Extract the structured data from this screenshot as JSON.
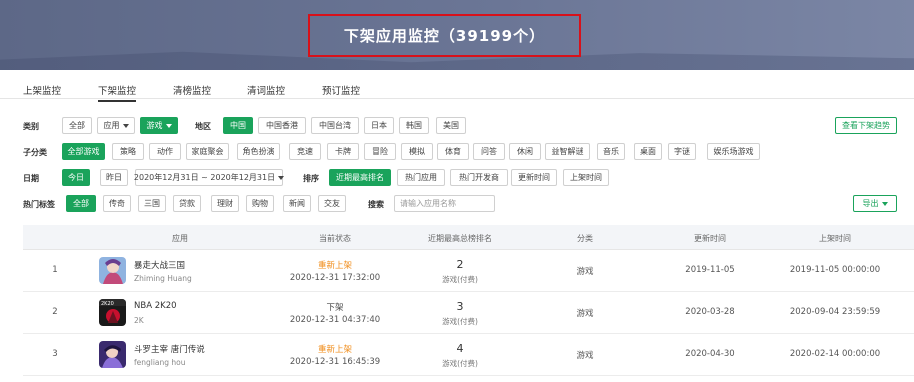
{
  "banner": {
    "title": "下架应用监控（39199个）"
  },
  "tabs": [
    {
      "label": "上架监控"
    },
    {
      "label": "下架监控"
    },
    {
      "label": "清榜监控"
    },
    {
      "label": "清词监控"
    },
    {
      "label": "预订监控"
    }
  ],
  "filters": {
    "category": {
      "label": "类别",
      "options": [
        "全部",
        "应用",
        "游戏"
      ],
      "region_label": "地区",
      "regions": [
        "中国",
        "中国香港",
        "中国台湾",
        "日本",
        "韩国",
        "美国"
      ],
      "trend_button": "查看下架趋势"
    },
    "subcategory": {
      "label": "子分类",
      "options": [
        "全部游戏",
        "策略",
        "动作",
        "家庭聚会",
        "角色扮演",
        "竞速",
        "卡牌",
        "冒险",
        "模拟",
        "体育",
        "问答",
        "休闲",
        "益智解谜",
        "音乐",
        "桌面",
        "字谜",
        "娱乐场游戏"
      ]
    },
    "date": {
      "label": "日期",
      "today": "今日",
      "yesterday": "昨日",
      "range": "2020年12月31日 ~ 2020年12月31日",
      "sort_label": "排序",
      "sorts": [
        "近期最高排名",
        "热门应用",
        "热门开发商",
        "更新时间",
        "上架时间"
      ]
    },
    "hot": {
      "label": "热门标签",
      "tags": [
        "全部",
        "传奇",
        "三国",
        "贷款",
        "理财",
        "购物",
        "新闻",
        "交友"
      ],
      "search_label": "搜索",
      "search_placeholder": "请输入应用名称",
      "export": "导出"
    }
  },
  "table": {
    "headers": [
      "应用",
      "当前状态",
      "近期最高总榜排名",
      "分类",
      "更新时间",
      "上架时间"
    ],
    "rows": [
      {
        "index": "1",
        "name": "暴走大战三国",
        "developer": "Zhiming Huang",
        "status": "重新上架",
        "status_type": "re",
        "status_time": "2020-12-31 17:32:00",
        "rank": "2",
        "rank_sub": "游戏(付费)",
        "category": "游戏",
        "updated": "2019-11-05",
        "listed": "2019-11-05 00:00:00",
        "icon": "game-icon-sanguo"
      },
      {
        "index": "2",
        "name": "NBA 2K20",
        "developer": "2K",
        "status": "下架",
        "status_type": "off",
        "status_time": "2020-12-31 04:37:40",
        "rank": "3",
        "rank_sub": "游戏(付费)",
        "category": "游戏",
        "updated": "2020-03-28",
        "listed": "2020-09-04 23:59:59",
        "icon": "game-icon-nba"
      },
      {
        "index": "3",
        "name": "斗罗主宰 唐门传说",
        "developer": "fengliang hou",
        "status": "重新上架",
        "status_type": "re",
        "status_time": "2020-12-31 16:45:39",
        "rank": "4",
        "rank_sub": "游戏(付费)",
        "category": "游戏",
        "updated": "2020-04-30",
        "listed": "2020-02-14 00:00:00",
        "icon": "game-icon-douluo"
      }
    ]
  },
  "colors": {
    "accent": "#1aa35b",
    "highlight_box": "#d8111a",
    "status_re": "#f08c1a"
  }
}
